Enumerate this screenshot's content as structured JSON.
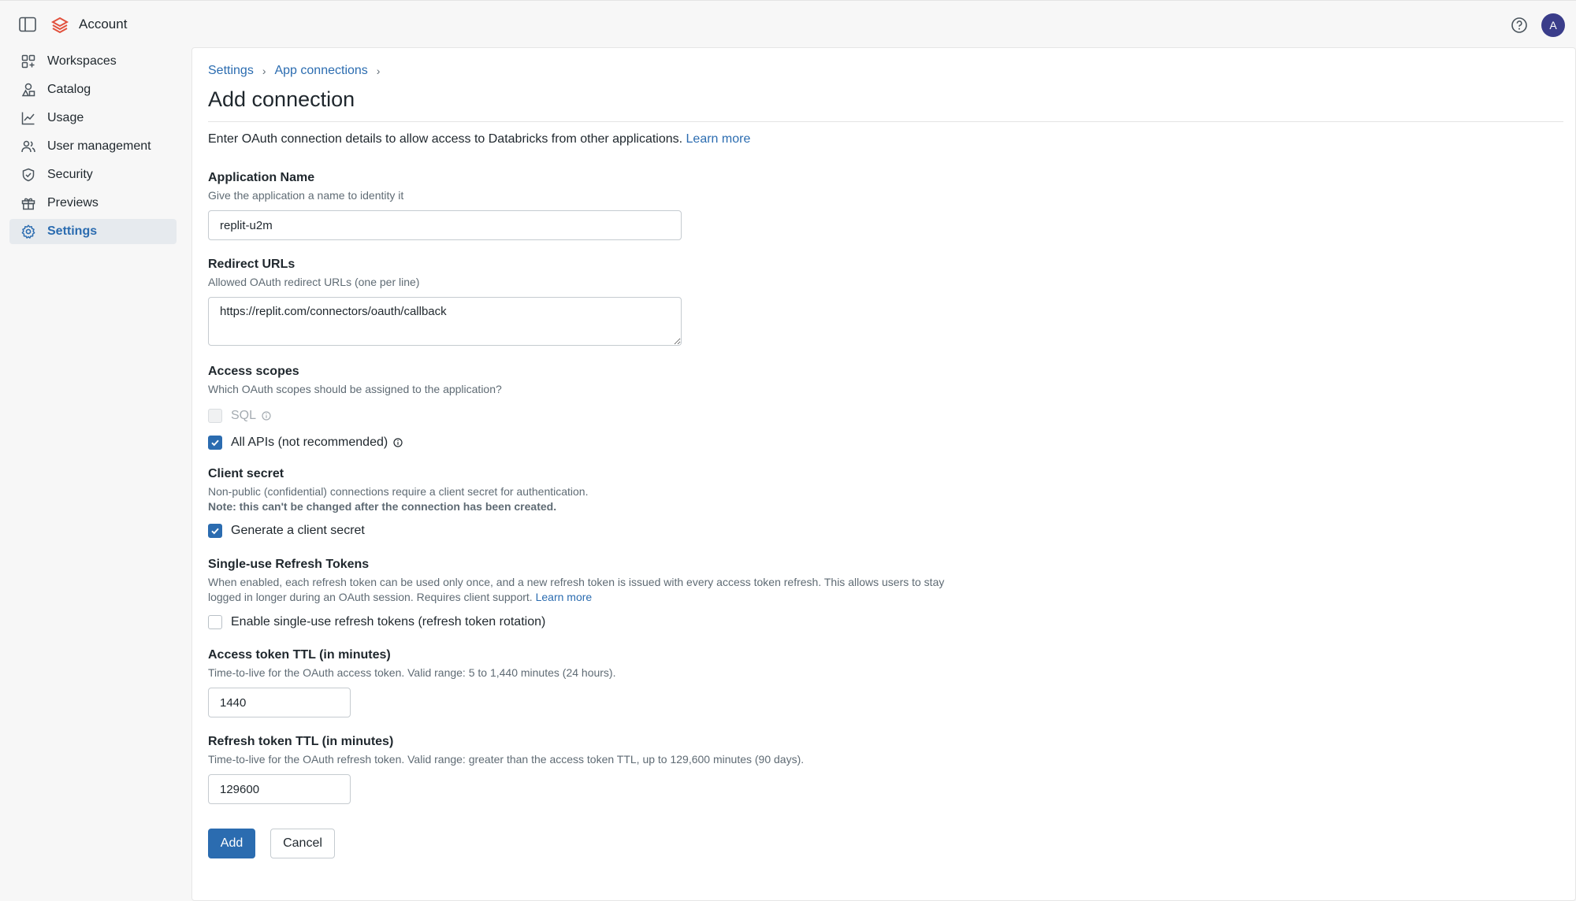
{
  "header": {
    "title": "Account",
    "avatar_initial": "A"
  },
  "sidebar": {
    "items": [
      {
        "label": "Workspaces",
        "icon": "workspaces-icon"
      },
      {
        "label": "Catalog",
        "icon": "catalog-icon"
      },
      {
        "label": "Usage",
        "icon": "usage-chart-icon"
      },
      {
        "label": "User management",
        "icon": "users-icon"
      },
      {
        "label": "Security",
        "icon": "shield-icon"
      },
      {
        "label": "Previews",
        "icon": "gift-icon"
      },
      {
        "label": "Settings",
        "icon": "gear-icon",
        "active": true
      }
    ]
  },
  "breadcrumb": {
    "items": [
      "Settings",
      "App connections"
    ]
  },
  "page": {
    "title": "Add connection",
    "intro": "Enter OAuth connection details to allow access to Databricks from other applications.",
    "learn_more": "Learn more"
  },
  "form": {
    "app_name": {
      "label": "Application Name",
      "hint": "Give the application a name to identity it",
      "value": "replit-u2m"
    },
    "redirect_urls": {
      "label": "Redirect URLs",
      "hint": "Allowed OAuth redirect URLs (one per line)",
      "value": "https://replit.com/connectors/oauth/callback"
    },
    "access_scopes": {
      "label": "Access scopes",
      "hint": "Which OAuth scopes should be assigned to the application?",
      "sql_label": "SQL",
      "sql_checked": false,
      "sql_disabled": true,
      "all_apis_label": "All APIs (not recommended)",
      "all_apis_checked": true
    },
    "client_secret": {
      "label": "Client secret",
      "hint": "Non-public (confidential) connections require a client secret for authentication.",
      "note": "Note: this can't be changed after the connection has been created.",
      "checkbox_label": "Generate a client secret",
      "checked": true
    },
    "refresh_tokens": {
      "label": "Single-use Refresh Tokens",
      "hint": "When enabled, each refresh token can be used only once, and a new refresh token is issued with every access token refresh. This allows users to stay logged in longer during an OAuth session. Requires client support.",
      "learn_more": "Learn more",
      "checkbox_label": "Enable single-use refresh tokens (refresh token rotation)",
      "checked": false
    },
    "access_ttl": {
      "label": "Access token TTL (in minutes)",
      "hint": "Time-to-live for the OAuth access token. Valid range: 5 to 1,440 minutes (24 hours).",
      "value": "1440"
    },
    "refresh_ttl": {
      "label": "Refresh token TTL (in minutes)",
      "hint": "Time-to-live for the OAuth refresh token. Valid range: greater than the access token TTL, up to 129,600 minutes (90 days).",
      "value": "129600"
    }
  },
  "actions": {
    "add_label": "Add",
    "cancel_label": "Cancel"
  },
  "colors": {
    "accent": "#2b6cb0",
    "logo": "#e2513d",
    "avatar": "#3a3d8a"
  }
}
